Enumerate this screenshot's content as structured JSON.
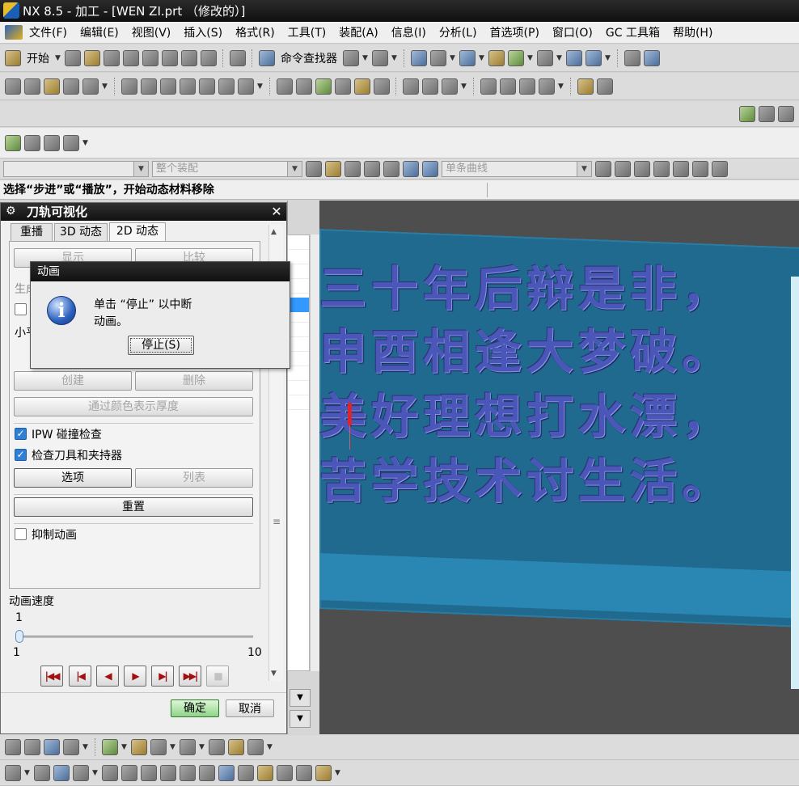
{
  "window": {
    "title": "NX 8.5 - 加工 - [WEN ZI.prt （修改的）]"
  },
  "menu": [
    "文件(F)",
    "编辑(E)",
    "视图(V)",
    "插入(S)",
    "格式(R)",
    "工具(T)",
    "装配(A)",
    "信息(I)",
    "分析(L)",
    "首选项(P)",
    "窗口(O)",
    "GC 工具箱",
    "帮助(H)"
  ],
  "toolbar": {
    "start_label": "开始",
    "command_finder_label": "命令查找器"
  },
  "selection_bar": {
    "assembly_filter": "整个装配",
    "curve_rule": "单条曲线"
  },
  "cue_line": "选择“步进”或“播放”，开始动态材料移除",
  "graphics": {
    "engraved_lines": [
      "三十年后辩是非，",
      "申酉相逢大梦破。",
      "美好理想打水漂，",
      "苦学技术讨生活。"
    ],
    "workpiece_color": "#1f6a8e",
    "text_color": "#4a56b8"
  },
  "dialog": {
    "title": "刀轨可视化",
    "tabs": [
      "重播",
      "3D 动态",
      "2D 动态"
    ],
    "active_tab": "2D 动态",
    "show_button": "显示",
    "compare_button": "比较",
    "generate_label_partial": "生成",
    "small_label_partial": "小平",
    "create_button": "创建",
    "delete_button": "删除",
    "thickness_button": "通过颜色表示厚度",
    "ipw_check_label": "IPW 碰撞检查",
    "ipw_checked": true,
    "check_tool_label": "检查刀具和夹持器",
    "check_tool_checked": true,
    "options_button": "选项",
    "list_button": "列表",
    "reset_button": "重置",
    "suppress_label": "抑制动画",
    "suppress_checked": false,
    "speed_label": "动画速度",
    "speed_value": "1",
    "speed_min": "1",
    "speed_max": "10",
    "speed_fraction": 0,
    "ok_button": "确定",
    "cancel_button": "取消"
  },
  "animation_box": {
    "title": "动画",
    "message_line1": "单击 “停止” 以中断",
    "message_line2": "动画。",
    "stop_button": "停止(S)"
  }
}
